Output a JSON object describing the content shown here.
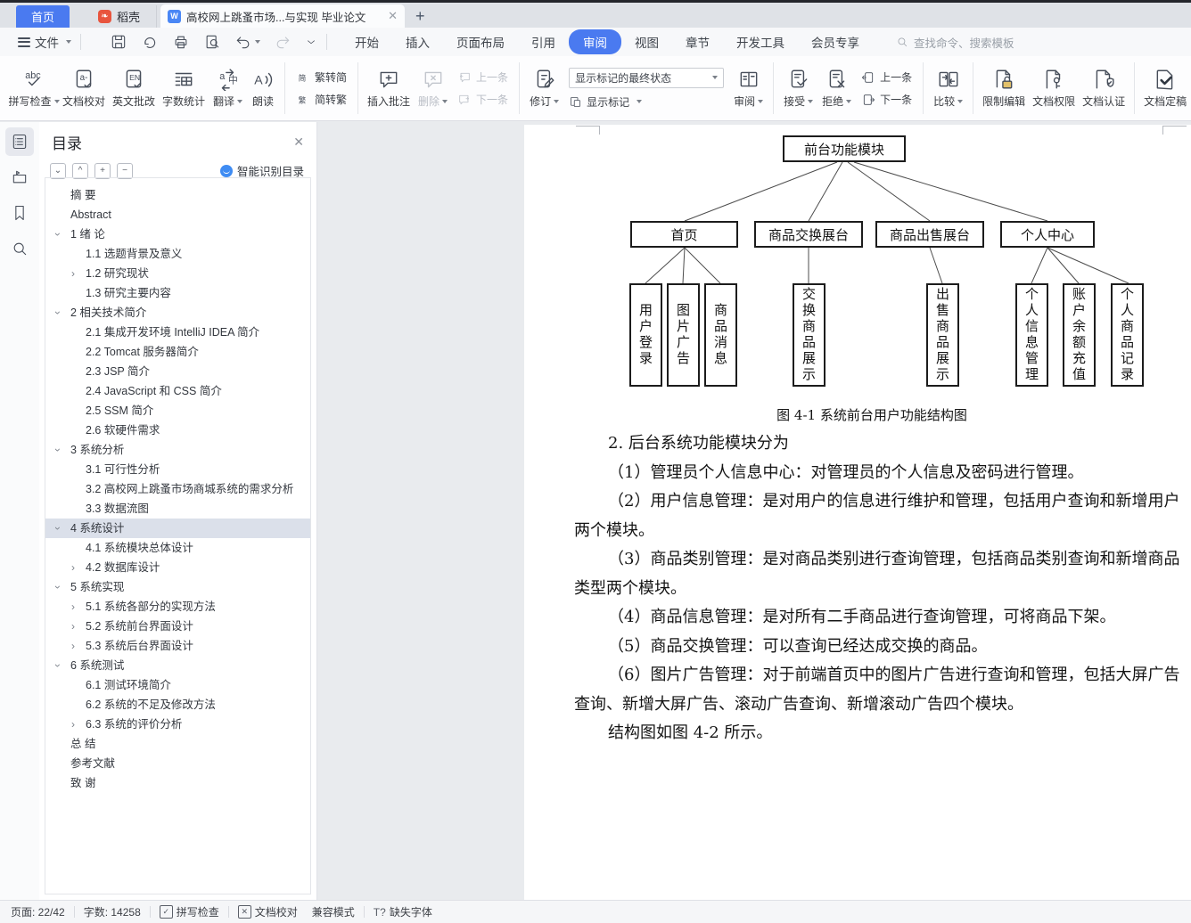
{
  "colors": {
    "accent": "#4a7af0",
    "toc_selected": "#dbe0ea",
    "tabbar_bg": "#dfe2e7"
  },
  "titlebar": {
    "tabs": [
      {
        "label": "首页"
      },
      {
        "label": "稻壳"
      },
      {
        "label": "高校网上跳蚤市场...与实现 毕业论文"
      }
    ]
  },
  "menubar": {
    "file_label": "文件",
    "tabs": [
      "开始",
      "插入",
      "页面布局",
      "引用",
      "审阅",
      "视图",
      "章节",
      "开发工具",
      "会员专享"
    ],
    "active_tab": "审阅",
    "search_placeholder": "查找命令、搜索模板"
  },
  "ribbon": {
    "spell_check": "拼写检查",
    "doc_proof": "文档校对",
    "english_correct": "英文批改",
    "word_count": "字数统计",
    "translate": "翻译",
    "read_aloud": "朗读",
    "trad_to_simp": "繁转简",
    "simp_to_trad": "简转繁",
    "insert_comment": "插入批注",
    "delete": "删除",
    "prev_item": "上一条",
    "next_item": "下一条",
    "track_changes": "修订",
    "markup_state_value": "显示标记的最终状态",
    "show_markup": "显示标记",
    "review_pane": "审阅",
    "accept": "接受",
    "reject": "拒绝",
    "prev_change": "上一条",
    "next_change": "下一条",
    "compare": "比较",
    "restrict_edit": "限制编辑",
    "doc_permission": "文档权限",
    "doc_auth": "文档认证",
    "doc_final": "文档定稿"
  },
  "toc": {
    "title": "目录",
    "smart_label": "智能识别目录",
    "items": [
      {
        "label": "摘  要",
        "level": 0
      },
      {
        "label": "Abstract",
        "level": 0
      },
      {
        "label": "1 绪 论",
        "level": 0,
        "arrow": "down"
      },
      {
        "label": "1.1 选题背景及意义",
        "level": 1
      },
      {
        "label": "1.2 研究现状",
        "level": 1,
        "arrow": "right"
      },
      {
        "label": "1.3 研究主要内容",
        "level": 1
      },
      {
        "label": "2 相关技术简介",
        "level": 0,
        "arrow": "down"
      },
      {
        "label": "2.1 集成开发环境 IntelliJ IDEA 简介",
        "level": 1
      },
      {
        "label": "2.2 Tomcat 服务器简介",
        "level": 1
      },
      {
        "label": "2.3 JSP 简介",
        "level": 1
      },
      {
        "label": "2.4 JavaScript 和 CSS 简介",
        "level": 1
      },
      {
        "label": "2.5 SSM 简介",
        "level": 1
      },
      {
        "label": "2.6 软硬件需求",
        "level": 1
      },
      {
        "label": "3 系统分析",
        "level": 0,
        "arrow": "down"
      },
      {
        "label": "3.1 可行性分析",
        "level": 1
      },
      {
        "label": "3.2 高校网上跳蚤市场商城系统的需求分析",
        "level": 1
      },
      {
        "label": "3.3 数据流图",
        "level": 1
      },
      {
        "label": "4 系统设计",
        "level": 0,
        "arrow": "down",
        "selected": true
      },
      {
        "label": "4.1 系统模块总体设计",
        "level": 1
      },
      {
        "label": "4.2 数据库设计",
        "level": 1,
        "arrow": "right"
      },
      {
        "label": "5 系统实现",
        "level": 0,
        "arrow": "down"
      },
      {
        "label": "5.1 系统各部分的实现方法",
        "level": 1,
        "arrow": "right"
      },
      {
        "label": "5.2 系统前台界面设计",
        "level": 1,
        "arrow": "right"
      },
      {
        "label": "5.3 系统后台界面设计",
        "level": 1,
        "arrow": "right"
      },
      {
        "label": "6 系统测试",
        "level": 0,
        "arrow": "down"
      },
      {
        "label": "6.1 测试环境简介",
        "level": 1
      },
      {
        "label": "6.2 系统的不足及修改方法",
        "level": 1
      },
      {
        "label": "6.3 系统的评价分析",
        "level": 1,
        "arrow": "right"
      },
      {
        "label": "总  结",
        "level": 0
      },
      {
        "label": "参考文献",
        "level": 0
      },
      {
        "label": "致  谢",
        "level": 0
      }
    ]
  },
  "document": {
    "figure": {
      "root": "前台功能模块",
      "branches": [
        {
          "label": "首页",
          "children": [
            "用户登录",
            "图片广告",
            "商品消息"
          ]
        },
        {
          "label": "商品交换展台",
          "children": [
            "交换商品展示"
          ]
        },
        {
          "label": "商品出售展台",
          "children": [
            "出售商品展示"
          ]
        },
        {
          "label": "个人中心",
          "children": [
            "个人信息管理",
            "账户余额充值",
            "个人商品记录"
          ]
        }
      ],
      "caption": "图 4-1  系统前台用户功能结构图"
    },
    "lines": [
      {
        "text": "2.  后台系统功能模块分为",
        "indent": true
      },
      {
        "text": "（1）管理员个人信息中心：对管理员的个人信息及密码进行管理。",
        "indent": true
      },
      {
        "text": "（2）用户信息管理：是对用户的信息进行维护和管理，包括用户查询和新增用户",
        "indent": true
      },
      {
        "text": "两个模块。",
        "indent": false
      },
      {
        "text": "（3）商品类别管理：是对商品类别进行查询管理，包括商品类别查询和新增商品",
        "indent": true
      },
      {
        "text": "类型两个模块。",
        "indent": false
      },
      {
        "text": "（4）商品信息管理：是对所有二手商品进行查询管理，可将商品下架。",
        "indent": true
      },
      {
        "text": "（5）商品交换管理：可以查询已经达成交换的商品。",
        "indent": true
      },
      {
        "text": "（6）图片广告管理：对于前端首页中的图片广告进行查询和管理，包括大屏广告",
        "indent": true
      },
      {
        "text": "查询、新增大屏广告、滚动广告查询、新增滚动广告四个模块。",
        "indent": false
      },
      {
        "text": "结构图如图 4-2 所示。",
        "indent": true
      }
    ]
  },
  "statusbar": {
    "page": "页面: 22/42",
    "words": "字数: 14258",
    "spell": "拼写检查",
    "proof": "文档校对",
    "compat": "兼容模式",
    "missing_font": "缺失字体"
  }
}
